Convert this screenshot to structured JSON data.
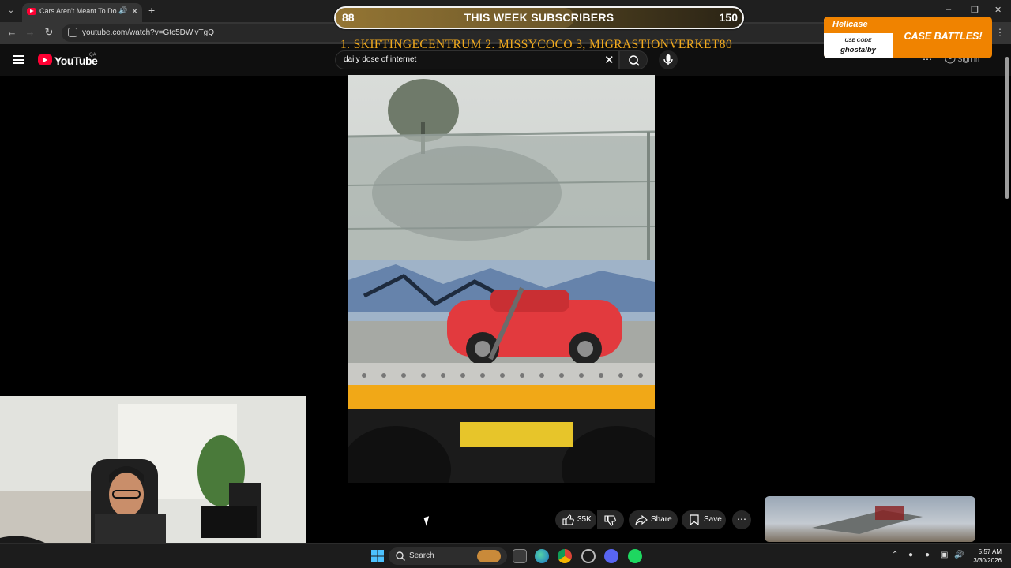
{
  "browser": {
    "tab": {
      "title": "Cars Aren't Meant To Do Th",
      "favicon": "youtube-favicon-icon",
      "audio_icon": "speaker-icon"
    },
    "url": "youtube.com/watch?v=Gtc5DWlvTgQ"
  },
  "youtube": {
    "logo_text": "YouTube",
    "country_code": "QA",
    "search": {
      "value": "daily dose of internet"
    },
    "signin_label": "Sign in"
  },
  "overlay": {
    "subscribers": {
      "current": "88",
      "label": "THIS WEEK SUBSCRIBERS",
      "goal": "150",
      "progress": 0.587
    },
    "top_subs": "1. SKIFTINGECENTRUM  2. MISSYCOCO  3, MIGRASTIONVERKET80",
    "sponsor": {
      "brand": "Hellcase",
      "use_code": "USE CODE",
      "code": "ghostalby",
      "cta": "CASE BATTLES!"
    }
  },
  "actions": {
    "likes": "35K",
    "share_label": "Share",
    "save_label": "Save"
  },
  "taskbar": {
    "search_label": "Search",
    "time": "5:57 AM",
    "date": "3/30/2026"
  },
  "colors": {
    "accent": "#ff0033",
    "overlay_text": "#f0a91e",
    "sponsor": "#f08300"
  }
}
